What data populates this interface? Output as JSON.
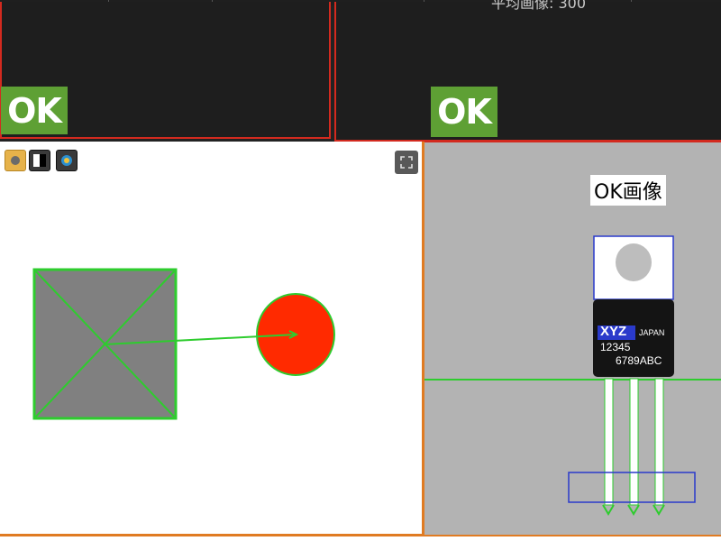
{
  "top": {
    "partial_text": "平均画像:     300"
  },
  "panels": {
    "top_left": {
      "status": "OK"
    },
    "top_right": {
      "status": "OK"
    }
  },
  "toolbar": {
    "buttons": [
      {
        "name": "camera-mode-icon",
        "color": "#e6b24a"
      },
      {
        "name": "contrast-icon",
        "color": "#3a3a3a"
      },
      {
        "name": "color-filter-icon",
        "color": "#3a3a3a"
      }
    ],
    "expand": "expand-icon"
  },
  "right_view": {
    "label": "OK画像",
    "chip": {
      "brand": "XYZ",
      "origin": "JAPAN",
      "line1": "12345",
      "line2": "6789ABC"
    }
  },
  "colors": {
    "ok_green": "#5ea034",
    "panel_border_red": "#d32a1f",
    "view_border_orange": "#e07b22",
    "detect_green": "#2ecc2e",
    "target_red": "#ff2a00",
    "roi_blue": "#2a3acb"
  }
}
